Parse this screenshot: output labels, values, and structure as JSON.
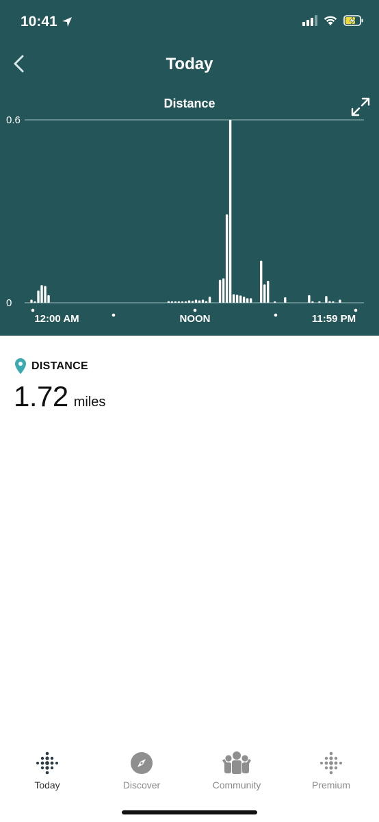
{
  "status_bar": {
    "time": "10:41"
  },
  "header": {
    "title": "Today"
  },
  "chart_title": "Distance",
  "chart_data": {
    "type": "bar",
    "title": "Distance",
    "ylim": [
      0,
      0.6
    ],
    "y_ticks": [
      "0.6",
      "0"
    ],
    "x_tick_labels": [
      "12:00 AM",
      "NOON",
      "11:59 PM"
    ],
    "grid": true,
    "categories": [
      "00:00",
      "00:15",
      "00:30",
      "00:45",
      "01:00",
      "01:15",
      "01:30",
      "01:45",
      "02:00",
      "02:15",
      "02:30",
      "02:45",
      "03:00",
      "03:15",
      "03:30",
      "03:45",
      "04:00",
      "04:15",
      "04:30",
      "04:45",
      "05:00",
      "05:15",
      "05:30",
      "05:45",
      "06:00",
      "06:15",
      "06:30",
      "06:45",
      "07:00",
      "07:15",
      "07:30",
      "07:45",
      "08:00",
      "08:15",
      "08:30",
      "08:45",
      "09:00",
      "09:15",
      "09:30",
      "09:45",
      "10:00",
      "10:15",
      "10:30",
      "10:45",
      "11:00",
      "11:15",
      "11:30",
      "11:45",
      "12:00",
      "12:15",
      "12:30",
      "12:45",
      "13:00",
      "13:15",
      "13:30",
      "13:45",
      "14:00",
      "14:15",
      "14:30",
      "14:45",
      "15:00",
      "15:15",
      "15:30",
      "15:45",
      "16:00",
      "16:15",
      "16:30",
      "16:45",
      "17:00",
      "17:15",
      "17:30",
      "17:45",
      "18:00",
      "18:15",
      "18:30",
      "18:45",
      "19:00",
      "19:15",
      "19:30",
      "19:45",
      "20:00",
      "20:15",
      "20:30",
      "20:45",
      "21:00",
      "21:15",
      "21:30",
      "21:45",
      "22:00",
      "22:15",
      "22:30",
      "22:45",
      "23:00",
      "23:15",
      "23:30",
      "23:45"
    ],
    "values": [
      0.01,
      0.002,
      0.04,
      0.058,
      0.055,
      0.025,
      0,
      0,
      0,
      0,
      0,
      0,
      0,
      0,
      0,
      0,
      0,
      0,
      0,
      0,
      0,
      0,
      0,
      0,
      0,
      0,
      0,
      0,
      0,
      0,
      0,
      0,
      0,
      0,
      0,
      0,
      0,
      0,
      0,
      0,
      0.005,
      0.003,
      0.002,
      0.002,
      0.003,
      0.003,
      0.008,
      0.006,
      0.01,
      0.008,
      0.01,
      0.005,
      0.02,
      0,
      0,
      0.075,
      0.08,
      0.29,
      0.6,
      0.028,
      0.026,
      0.024,
      0.02,
      0.015,
      0.015,
      0,
      0,
      0.138,
      0.06,
      0.072,
      0,
      0.002,
      0,
      0,
      0.018,
      0,
      0,
      0,
      0,
      0,
      0,
      0.025,
      0.003,
      0,
      0.003,
      0,
      0.022,
      0.005,
      0.003,
      0,
      0.01,
      0,
      0,
      0,
      0,
      0
    ],
    "series": [
      {
        "values": []
      }
    ]
  },
  "section": {
    "label": "DISTANCE"
  },
  "metric": {
    "value": "1.72",
    "unit": "miles"
  },
  "tabs": [
    {
      "label": "Today",
      "icon": "today-dots-icon",
      "active": true
    },
    {
      "label": "Discover",
      "icon": "compass-icon",
      "active": false
    },
    {
      "label": "Community",
      "icon": "community-icon",
      "active": false
    },
    {
      "label": "Premium",
      "icon": "premium-dots-icon",
      "active": false
    }
  ],
  "colors": {
    "header_bg": "#245659",
    "accent": "#3aa9b0",
    "bar": "#ffffff"
  }
}
